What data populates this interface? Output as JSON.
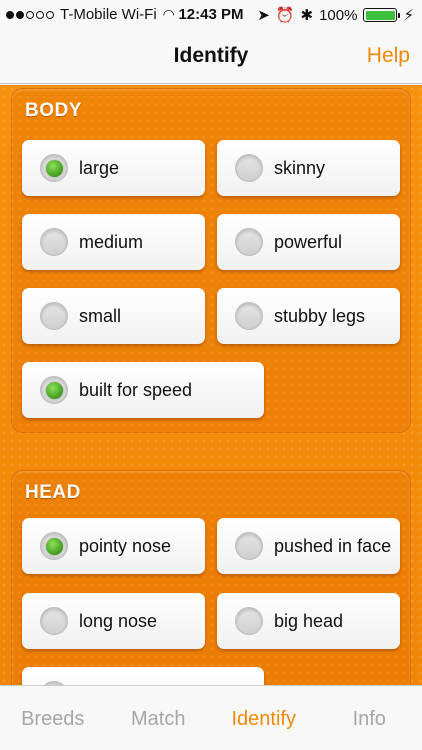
{
  "status": {
    "carrier": "T-Mobile Wi-Fi",
    "time": "12:43 PM",
    "battery": "100%"
  },
  "nav": {
    "title": "Identify",
    "help_label": "Help"
  },
  "sections": {
    "body": {
      "title": "BODY",
      "options": [
        {
          "label": "large",
          "checked": true
        },
        {
          "label": "skinny",
          "checked": false
        },
        {
          "label": "medium",
          "checked": false
        },
        {
          "label": "powerful",
          "checked": false
        },
        {
          "label": "small",
          "checked": false
        },
        {
          "label": "stubby legs",
          "checked": false
        },
        {
          "label": "built for speed",
          "checked": true
        }
      ]
    },
    "head": {
      "title": "HEAD",
      "options": [
        {
          "label": "pointy nose",
          "checked": true
        },
        {
          "label": "pushed in face",
          "checked": false
        },
        {
          "label": "long nose",
          "checked": false
        },
        {
          "label": "big head",
          "checked": false
        },
        {
          "label": "",
          "checked": false
        }
      ]
    }
  },
  "tabs": [
    {
      "label": "Breeds",
      "active": false
    },
    {
      "label": "Match",
      "active": false
    },
    {
      "label": "Identify",
      "active": true
    },
    {
      "label": "Info",
      "active": false
    }
  ],
  "colors": {
    "accent": "#f0880c",
    "background_orange": "#f28a0c",
    "radio_selected": "#4caf26"
  }
}
